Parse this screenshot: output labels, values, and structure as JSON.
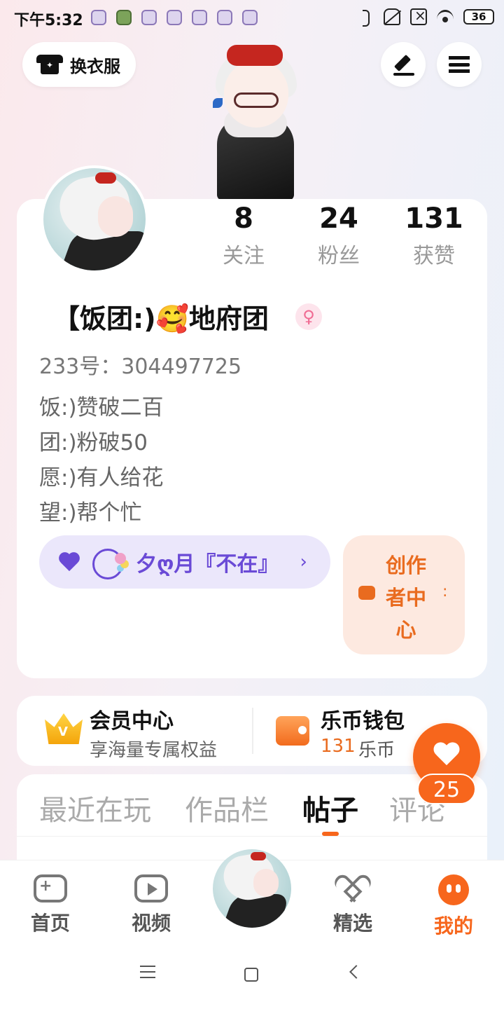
{
  "status_bar": {
    "time": "下午5:32",
    "battery": "36"
  },
  "header": {
    "wardrobe_label": "换衣服"
  },
  "profile": {
    "stats": [
      {
        "value": "8",
        "label": "关注"
      },
      {
        "value": "24",
        "label": "粉丝"
      },
      {
        "value": "131",
        "label": "获赞"
      }
    ],
    "nickname": "【饭团:)🥰地府团",
    "gender_symbol": "♀",
    "uid": "233号：304497725",
    "bio": [
      "饭:)赞破二百",
      "团:)粉破50",
      "愿:)有人给花",
      "望:)帮个忙"
    ],
    "guild_name": "夕ღ月『不在』",
    "guild_chevron": "›",
    "creator_center": "创作者中心"
  },
  "member": {
    "title": "会员中心",
    "subtitle": "享海量专属权益"
  },
  "wallet": {
    "title": "乐币钱包",
    "amount": "131",
    "unit": "乐币"
  },
  "like_fab": {
    "count": "25"
  },
  "tabs": [
    {
      "label": "最近在玩",
      "active": false
    },
    {
      "label": "作品栏",
      "active": false
    },
    {
      "label": "帖子",
      "active": true
    },
    {
      "label": "评论",
      "active": false
    }
  ],
  "bottom_nav": [
    {
      "label": "首页",
      "icon": "gamepad-icon"
    },
    {
      "label": "视频",
      "icon": "video-icon"
    },
    {
      "label": "精选",
      "icon": "heart-icon"
    },
    {
      "label": "我的",
      "icon": "me-icon",
      "active": true
    }
  ],
  "colors": {
    "accent": "#f7661c",
    "guild": "#6a4ad6",
    "gender": "#f06b93"
  }
}
